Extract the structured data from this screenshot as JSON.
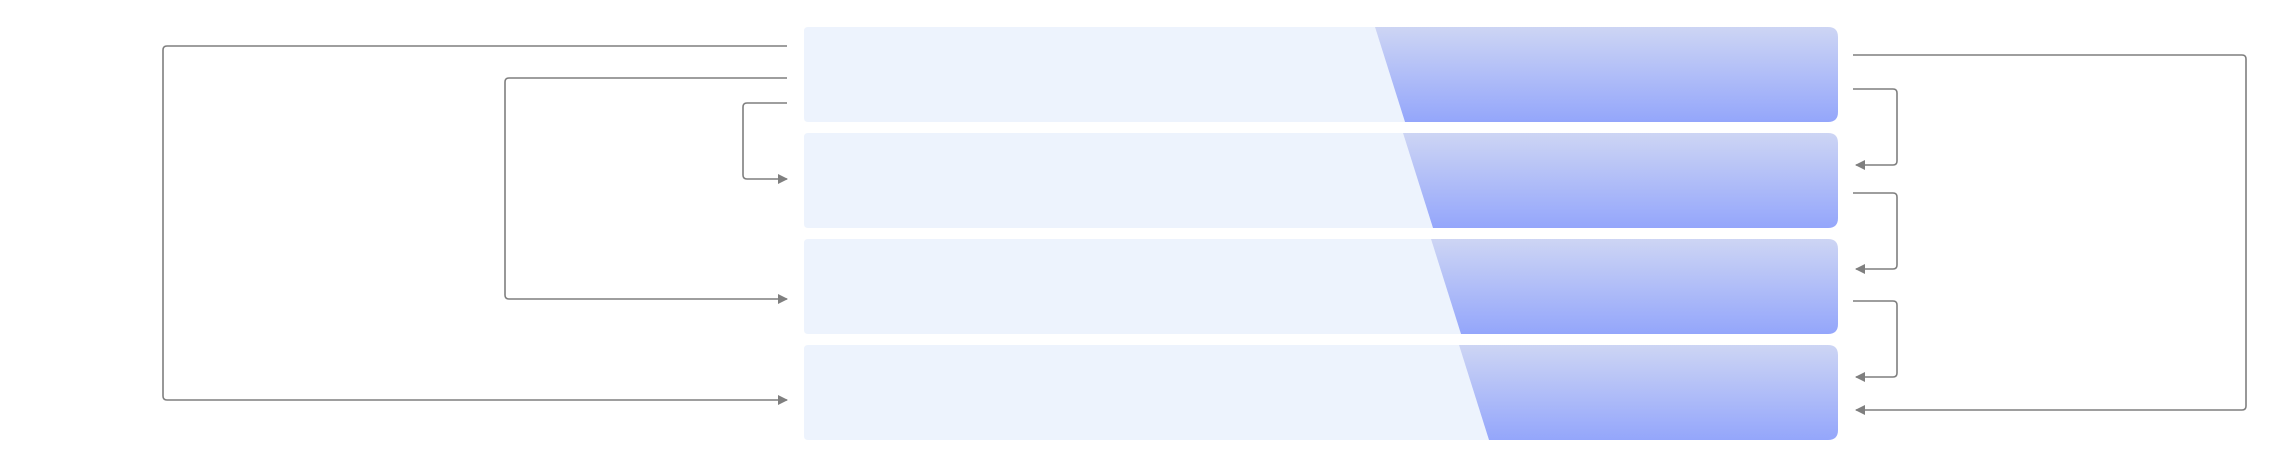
{
  "diagram": {
    "colors": {
      "background": "#ffffff",
      "left_panel": "#edf3fd",
      "right_panel_top": "#cdd5f4",
      "right_panel_bottom": "#94a6fb",
      "connector": "#7f7f7f"
    },
    "rows": [
      {
        "left_label": "",
        "right_label": ""
      },
      {
        "left_label": "",
        "right_label": ""
      },
      {
        "left_label": "",
        "right_label": ""
      },
      {
        "left_label": "",
        "right_label": ""
      }
    ],
    "left_connectors": [
      {
        "from_row": 0,
        "to_row": 1
      },
      {
        "from_row": 0,
        "to_row": 2
      },
      {
        "from_row": 0,
        "to_row": 3
      }
    ],
    "right_connectors": [
      {
        "from_row": 0,
        "to_row": 1
      },
      {
        "from_row": 1,
        "to_row": 2
      },
      {
        "from_row": 2,
        "to_row": 3
      },
      {
        "from_row": 0,
        "to_row": 3
      }
    ]
  }
}
